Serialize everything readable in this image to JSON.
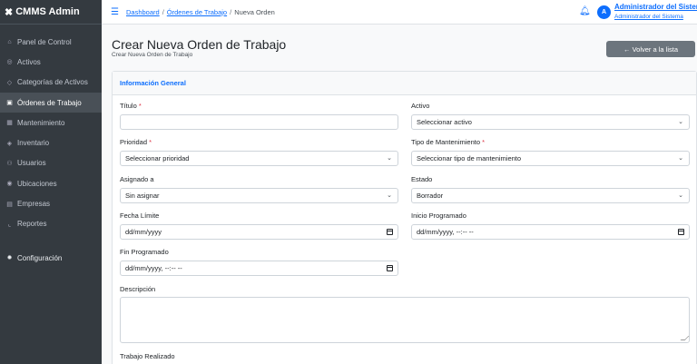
{
  "app": {
    "title": "CMMS Admin",
    "brand_icon": "tools-icon"
  },
  "sidebar": {
    "items": [
      {
        "label": "Panel de Control",
        "icon": "dashboard-icon"
      },
      {
        "label": "Activos",
        "icon": "gear-icon"
      },
      {
        "label": "Categorías de Activos",
        "icon": "tag-icon"
      },
      {
        "label": "Órdenes de Trabajo",
        "icon": "clipboard-icon",
        "active": true
      },
      {
        "label": "Mantenimiento",
        "icon": "calendar-icon"
      },
      {
        "label": "Inventario",
        "icon": "box-icon"
      },
      {
        "label": "Usuarios",
        "icon": "users-icon"
      },
      {
        "label": "Ubicaciones",
        "icon": "location-icon"
      },
      {
        "label": "Empresas",
        "icon": "building-icon"
      },
      {
        "label": "Reportes",
        "icon": "chart-icon"
      }
    ],
    "config": {
      "label": "Configuración",
      "icon": "settings-icon"
    }
  },
  "topbar": {
    "breadcrumb": [
      "Dashboard",
      "Órdenes de Trabajo",
      "Nueva Orden"
    ],
    "user_initial": "A",
    "user_name": "Administrador del Sistema",
    "user_role": "Administrador del Sistema"
  },
  "page": {
    "title": "Crear Nueva Orden de Trabajo",
    "subtitle": "Crear Nueva Orden de Trabajo",
    "back_label": "← Volver a la lista"
  },
  "form": {
    "section_title": "Información General",
    "titulo_label": "Título",
    "titulo_value": "",
    "activo_label": "Activo",
    "activo_value": "Seleccionar activo",
    "prioridad_label": "Prioridad",
    "prioridad_value": "Seleccionar prioridad",
    "tipo_label": "Tipo de Mantenimiento",
    "tipo_value": "Seleccionar tipo de mantenimiento",
    "asignado_label": "Asignado a",
    "asignado_value": "Sin asignar",
    "estado_label": "Estado",
    "estado_value": "Borrador",
    "fecha_limite_label": "Fecha Límite",
    "fecha_limite_value": "dd/mm/yyyy",
    "inicio_label": "Inicio Programado",
    "inicio_value": "dd/mm/yyyy, --:-- --",
    "fin_label": "Fin Programado",
    "fin_value": "dd/mm/yyyy, --:-- --",
    "descripcion_label": "Descripción",
    "trabajo_label": "Trabajo Realizado",
    "required_mark": "*"
  },
  "colors": {
    "accent": "#0d6efd",
    "sidebar": "#343a40",
    "danger": "#dc3545"
  }
}
